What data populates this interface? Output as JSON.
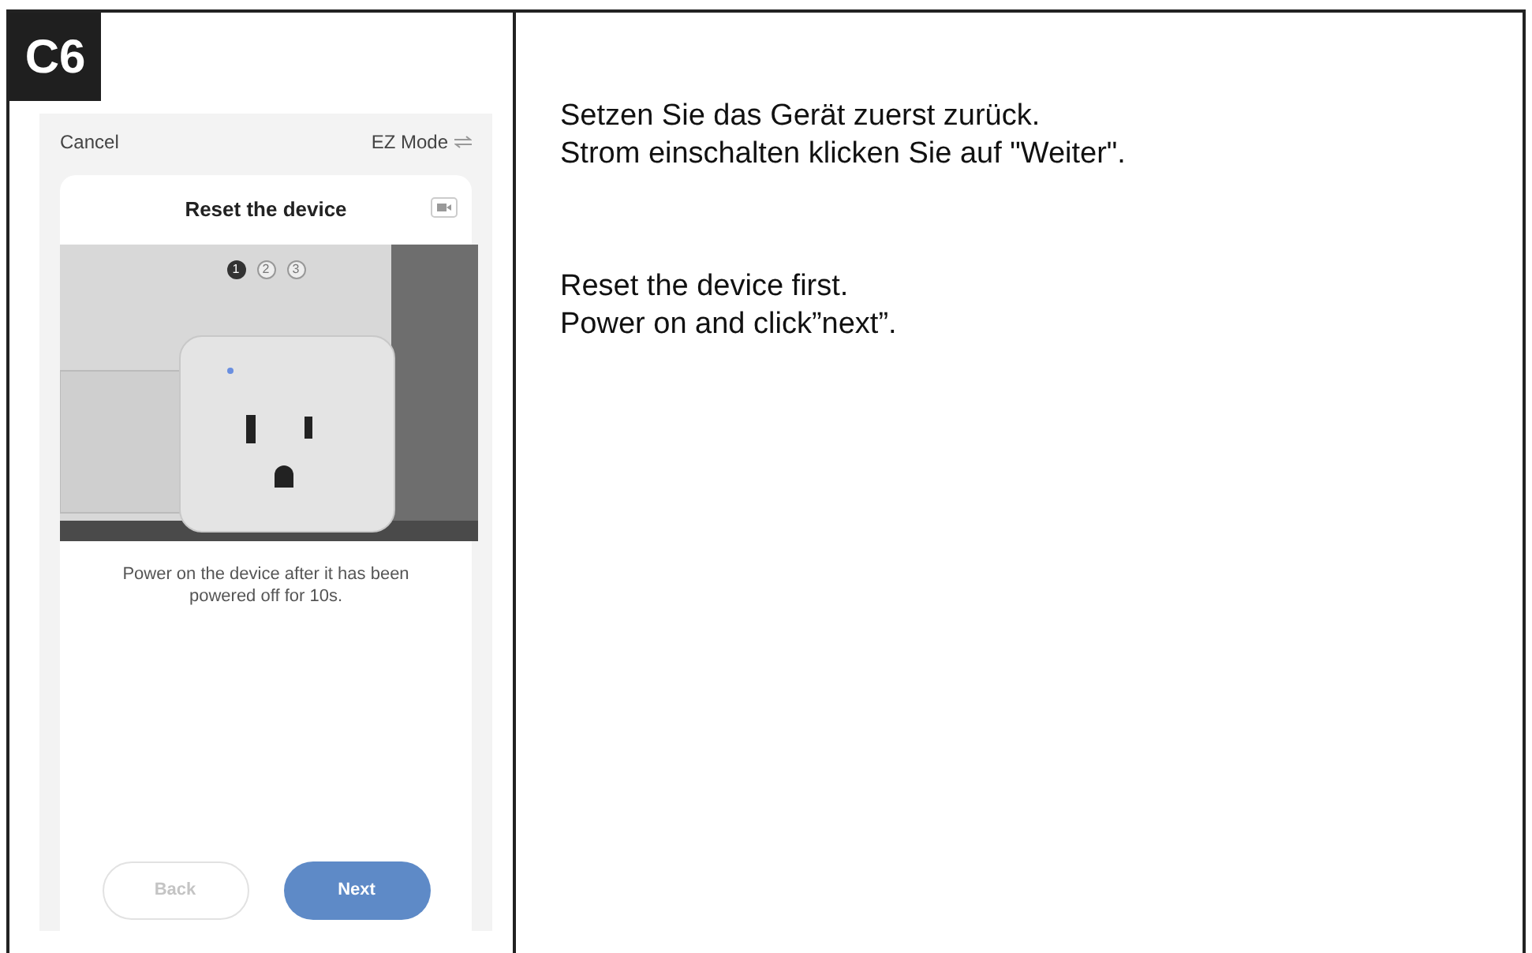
{
  "step_badge": "C6",
  "phone": {
    "cancel": "Cancel",
    "mode": "EZ Mode",
    "card": {
      "title": "Reset the device",
      "steps": [
        {
          "label": "1",
          "selected": true
        },
        {
          "label": "2",
          "selected": false
        },
        {
          "label": "3",
          "selected": false
        }
      ],
      "description": "Power on the device after it has been powered off for 10s.",
      "buttons": [
        {
          "label": "Back",
          "kind": "secondary"
        },
        {
          "label": "Next",
          "kind": "primary"
        }
      ]
    }
  },
  "instructions": [
    {
      "lines": [
        "Setzen Sie das Gerät zuerst zurück.",
        "Strom einschalten klicken Sie auf \"Weiter\"."
      ]
    },
    {
      "lines": [
        "Reset the device first.",
        "Power on and click”next”."
      ]
    }
  ]
}
